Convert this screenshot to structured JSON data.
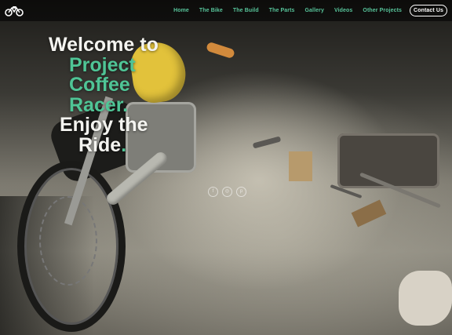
{
  "nav": {
    "items": [
      {
        "label": "Home"
      },
      {
        "label": "The Bike"
      },
      {
        "label": "The Build"
      },
      {
        "label": "The Parts"
      },
      {
        "label": "Gallery"
      },
      {
        "label": "Videos"
      },
      {
        "label": "Other Projects"
      }
    ],
    "contact_label": "Contact Us",
    "accent_color": "#57c39a",
    "logo_icon": "motorcycle-icon"
  },
  "hero": {
    "line1": "Welcome to",
    "line2": "Project",
    "line3": "Coffee",
    "line4": "Racer.",
    "line5": "Enjoy the",
    "line6": "Ride",
    "line6_punct": ".",
    "social_icons": [
      "facebook-icon",
      "instagram-icon",
      "pinterest-icon"
    ]
  }
}
